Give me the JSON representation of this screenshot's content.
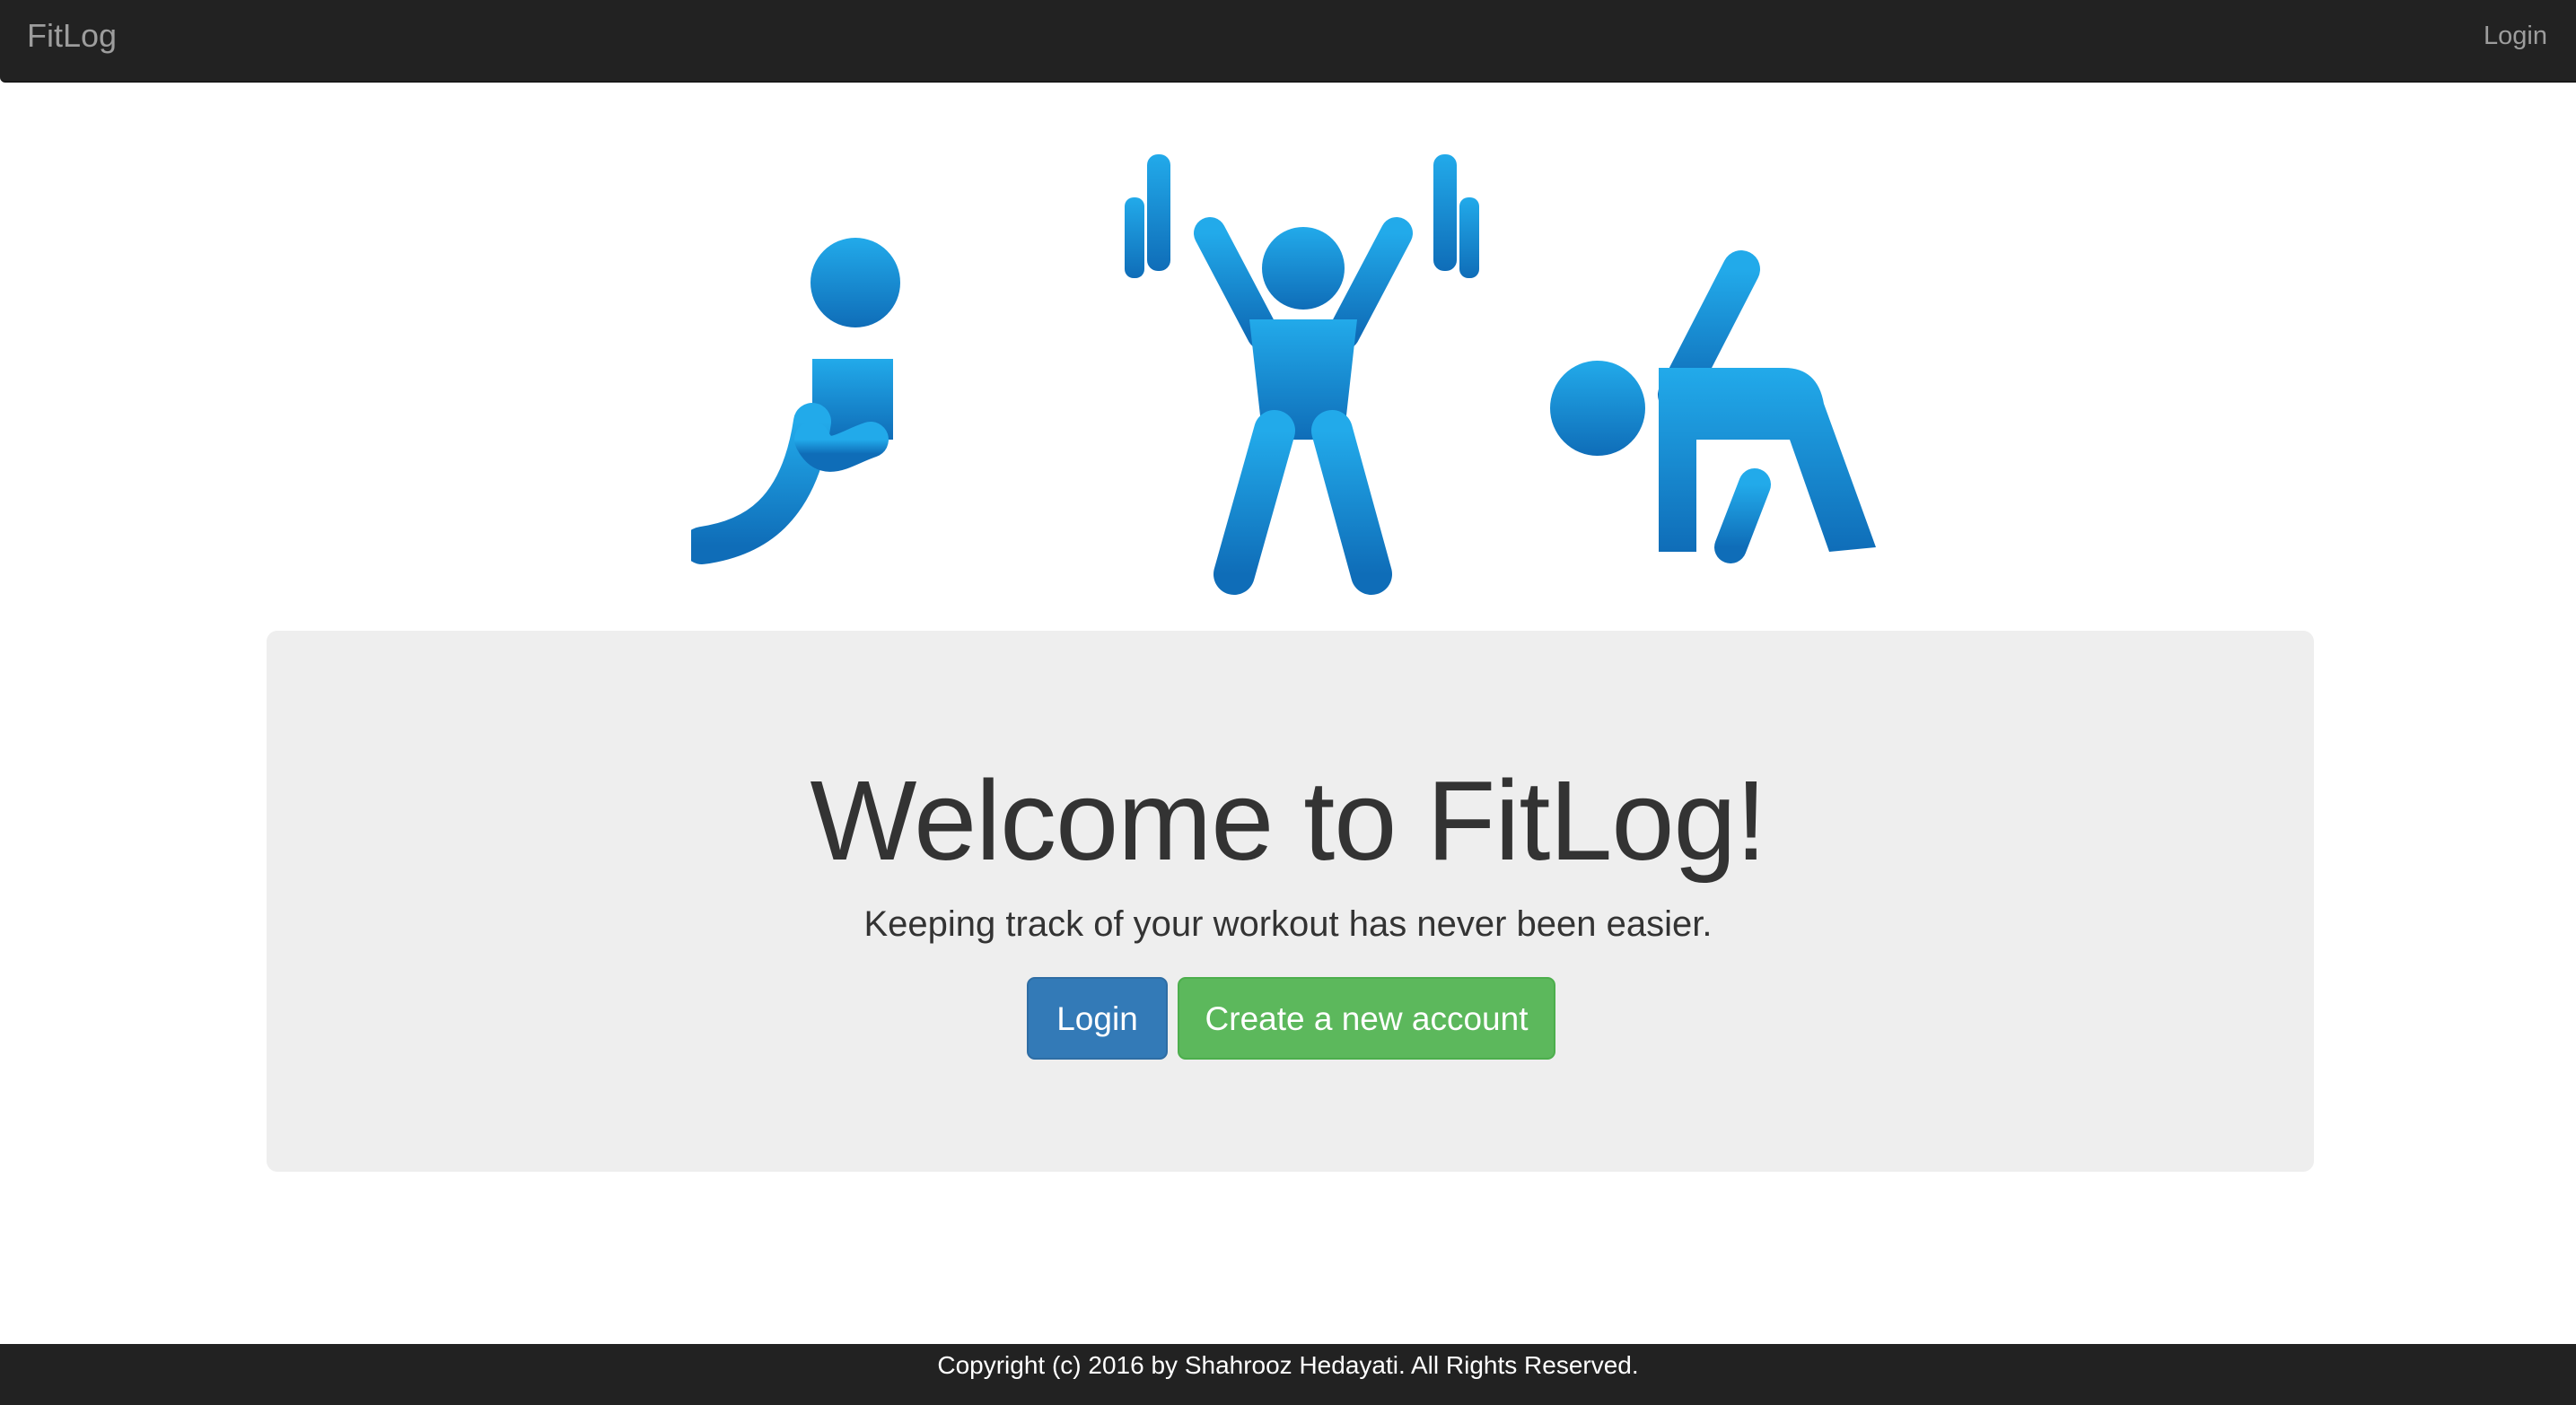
{
  "navbar": {
    "brand": "FitLog",
    "login_link": "Login"
  },
  "hero": {
    "icons": [
      "stretching-person-icon",
      "weightlifter-icon",
      "bending-person-icon"
    ],
    "icon_color": "#1c8fd8"
  },
  "jumbotron": {
    "title": "Welcome to FitLog!",
    "subtitle": "Keeping track of your workout has never been easier.",
    "login_button": "Login",
    "signup_button": "Create a new account"
  },
  "footer": {
    "copyright": "Copyright (c) 2016 by Shahrooz Hedayati. All Rights Reserved."
  },
  "colors": {
    "navbar_bg": "#222222",
    "navbar_text": "#9d9d9d",
    "jumbotron_bg": "#eeeeee",
    "primary": "#337ab7",
    "success": "#5cb85c"
  }
}
